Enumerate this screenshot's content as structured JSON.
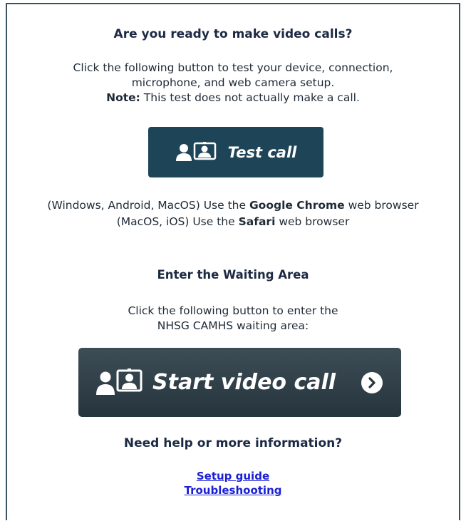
{
  "ready": {
    "title": "Are you ready to make video calls?",
    "line1": "Click the following button to test your device, connection,",
    "line2": "microphone, and web camera setup.",
    "note_label": "Note:",
    "note_text": " This test does not actually make a call."
  },
  "test_button": {
    "label": "Test call",
    "icon": "video-call-icon"
  },
  "browsers": {
    "line1_prefix": "(Windows, Android, MacOS) Use the ",
    "line1_bold": "Google Chrome",
    "line1_suffix": " web browser",
    "line2_prefix": "(MacOS, iOS) Use the ",
    "line2_bold": "Safari",
    "line2_suffix": " web browser"
  },
  "waiting": {
    "title": "Enter the Waiting Area",
    "line1": "Click the following button to enter the",
    "line2": "NHSG CAMHS waiting area:"
  },
  "start_button": {
    "label": "Start video call",
    "icon": "video-call-icon",
    "arrow_icon": "chevron-right-circle-icon"
  },
  "help": {
    "title": "Need help or more information?",
    "links": [
      "Setup guide",
      "Troubleshooting"
    ]
  },
  "colors": {
    "test_button_bg": "#1e4457",
    "start_button_bg": "#2f3f47",
    "link": "#1a1fd6",
    "border": "#3a5260"
  }
}
